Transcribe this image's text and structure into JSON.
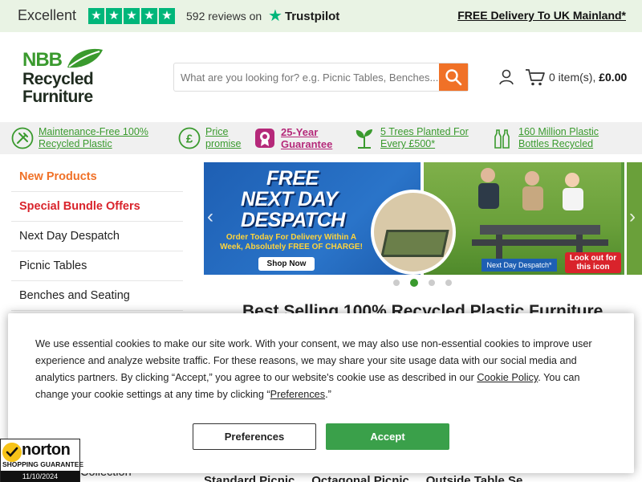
{
  "topbar": {
    "rating_word": "Excellent",
    "reviews": "592 reviews on",
    "trustpilot": "Trustpilot",
    "delivery": "FREE Delivery To UK Mainland*",
    "colors": {
      "trustpilot_green": "#00b67a",
      "bar_bg": "#e9f3e4"
    }
  },
  "logo": {
    "line1": "NBB",
    "line2": "Recycled",
    "line3": "Furniture"
  },
  "search": {
    "placeholder": "What are you looking for? e.g. Picnic Tables, Benches...",
    "button_icon": "search-icon"
  },
  "cart": {
    "count_label": "0 item(s),",
    "total": "£0.00"
  },
  "usp": [
    {
      "text": "Maintenance-Free 100% Recycled Plastic",
      "icon": "tools-icon"
    },
    {
      "text": "Price promise",
      "icon": "pound-icon"
    },
    {
      "text": "25-Year Guarantee",
      "icon": "award-icon"
    },
    {
      "text": "5 Trees Planted For Every £500*",
      "icon": "sapling-icon"
    },
    {
      "text": "160 Million Plastic Bottles Recycled",
      "icon": "bottles-icon"
    }
  ],
  "sidebar": {
    "items": [
      {
        "label": "New Products"
      },
      {
        "label": "Special Bundle Offers"
      },
      {
        "label": "Next Day Despatch"
      },
      {
        "label": "Picnic Tables"
      },
      {
        "label": "Benches and Seating"
      }
    ],
    "bottom_item": "Collection"
  },
  "banner": {
    "line1": "FREE",
    "line2": "NEXT DAY",
    "line3": "DESPATCH",
    "sub": "Order Today For Delivery Within A Week, Absolutely FREE OF CHARGE!",
    "shop": "Shop Now",
    "tag": "Next Day Despatch*",
    "look": "Look out for this icon",
    "active_slide": 2,
    "slide_count": 4
  },
  "heading": "Best Selling 100% Recycled Plastic Furniture",
  "categories_partial": "Standard Picnic ...    Octagonal Picnic ...    Outside Table Se...",
  "cookie": {
    "text_part1": "We use essential cookies to make our site work. With your consent, we may also use non-essential cookies to improve user experience and analyze website traffic. For these reasons, we may share your site usage data with our social media and analytics partners. By clicking “Accept,” you agree to our website's cookie use as described in our ",
    "policy_link": "Cookie Policy",
    "text_part2": ". You can change your cookie settings at any time by clicking “",
    "pref_link": "Preferences",
    "text_part3": ".”",
    "preferences_button": "Preferences",
    "accept_button": "Accept",
    "accept_color": "#3aa04a"
  },
  "norton": {
    "name": "norton",
    "guarantee": "SHOPPING GUARANTEE",
    "date": "11/10/2024"
  }
}
